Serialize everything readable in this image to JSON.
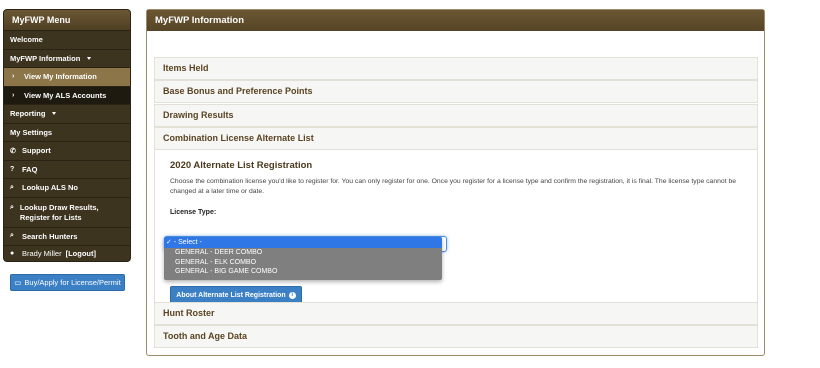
{
  "sidebar": {
    "header": "MyFWP Menu",
    "items": {
      "welcome": "Welcome",
      "myfwp_info": "MyFWP Information",
      "view_info": "View My Information",
      "view_als": "View My ALS Accounts",
      "reporting": "Reporting",
      "settings": "My Settings",
      "support": "Support",
      "faq": "FAQ",
      "lookup_als": "Lookup ALS No",
      "lookup_draw": "Lookup Draw Results, Register for Lists",
      "search_hunters": "Search Hunters"
    },
    "user": {
      "name": "Brady Miller",
      "logout": "[Logout]"
    },
    "buy_button": "Buy/Apply for License/Permit"
  },
  "main": {
    "title": "MyFWP Information",
    "sections": {
      "items_held": "Items Held",
      "base_bonus": "Base Bonus and Preference Points",
      "drawing_results": "Drawing Results",
      "combination": "Combination License Alternate List",
      "hunt_roster": "Hunt Roster",
      "tooth_age": "Tooth and Age Data"
    },
    "registration": {
      "title": "2020 Alternate List Registration",
      "description": "Choose the combination license you'd like to register for. You can only register for one. Once you register for a license type and confirm the registration, it is final. The license type cannot be changed at a later time or date.",
      "license_type_label": "License Type:",
      "options": {
        "select": "- Select -",
        "deer": "GENERAL - DEER COMBO",
        "elk": "GENERAL - ELK COMBO",
        "big_game": "GENERAL - BIG GAME COMBO"
      },
      "selected_option": "- Select -",
      "about_button": "About Alternate List Registration"
    }
  },
  "colors": {
    "header_brown": "#5e4d2d",
    "section_text": "#5a4423",
    "button_blue": "#3b7fc4",
    "select_highlight": "#2f76e6"
  }
}
